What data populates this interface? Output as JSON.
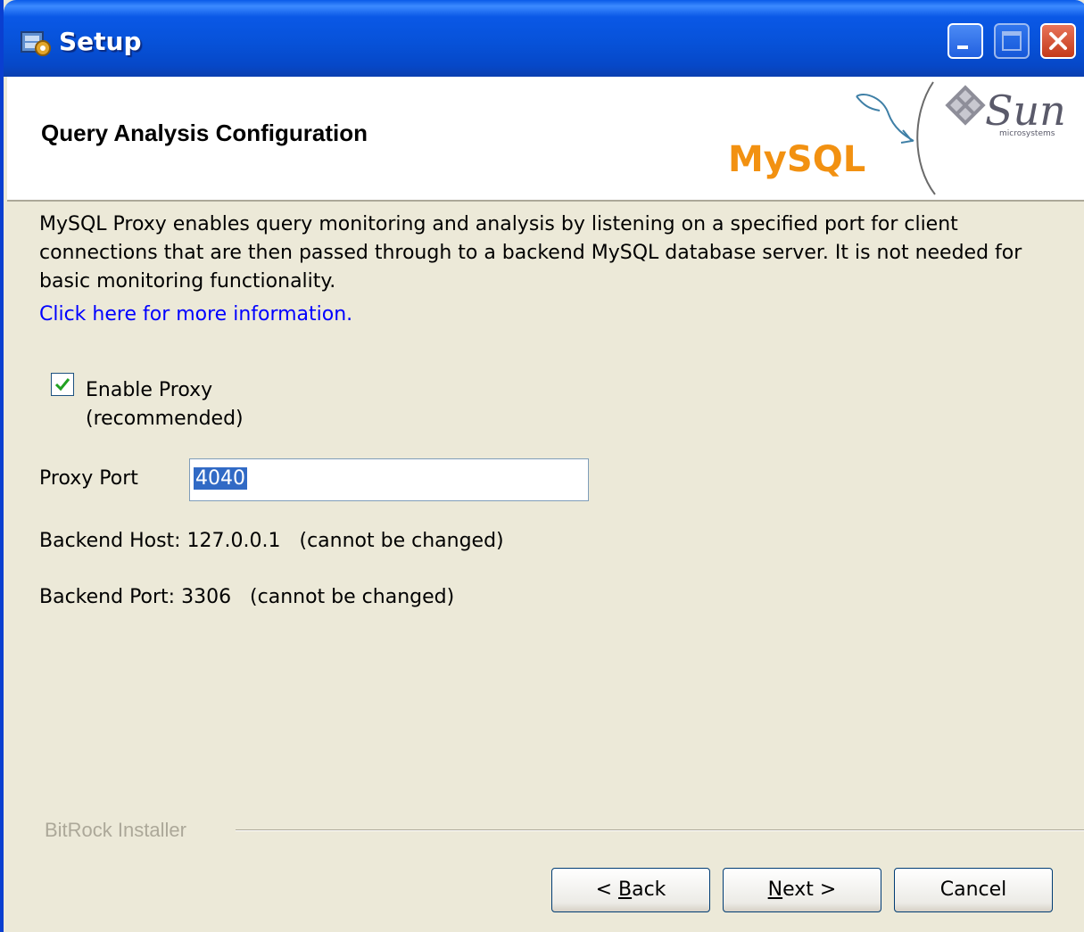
{
  "window": {
    "title": "Setup"
  },
  "header": {
    "page_title": "Query Analysis Configuration",
    "logos": [
      "mysql-logo",
      "sun-logo"
    ],
    "logo_text": {
      "mysql": "MySQL",
      "sun": "Sun",
      "sun_sub": "microsystems"
    }
  },
  "content": {
    "description": "MySQL Proxy enables query monitoring and analysis by listening on a specified port for client connections that are then passed through to a backend MySQL database server. It is not needed for basic monitoring functionality.",
    "info_link": "Click here for more information.",
    "enable_proxy": {
      "label_line1": "Enable Proxy",
      "label_line2": "(recommended)",
      "checked": true
    },
    "proxy_port": {
      "label": "Proxy Port",
      "value": "4040"
    },
    "backend_host": "Backend Host: 127.0.0.1   (cannot be changed)",
    "backend_port": "Backend Port: 3306   (cannot be changed)"
  },
  "footer": {
    "brand": "BitRock Installer",
    "buttons": {
      "back": {
        "prefix": "< ",
        "mnemonic": "B",
        "rest": "ack"
      },
      "next": {
        "mnemonic": "N",
        "rest": "ext >"
      },
      "cancel": "Cancel"
    }
  },
  "colors": {
    "titlebar": "#0752D9",
    "dialog_bg": "#ECE9D8",
    "link": "#0000FF",
    "selection": "#316AC5"
  }
}
